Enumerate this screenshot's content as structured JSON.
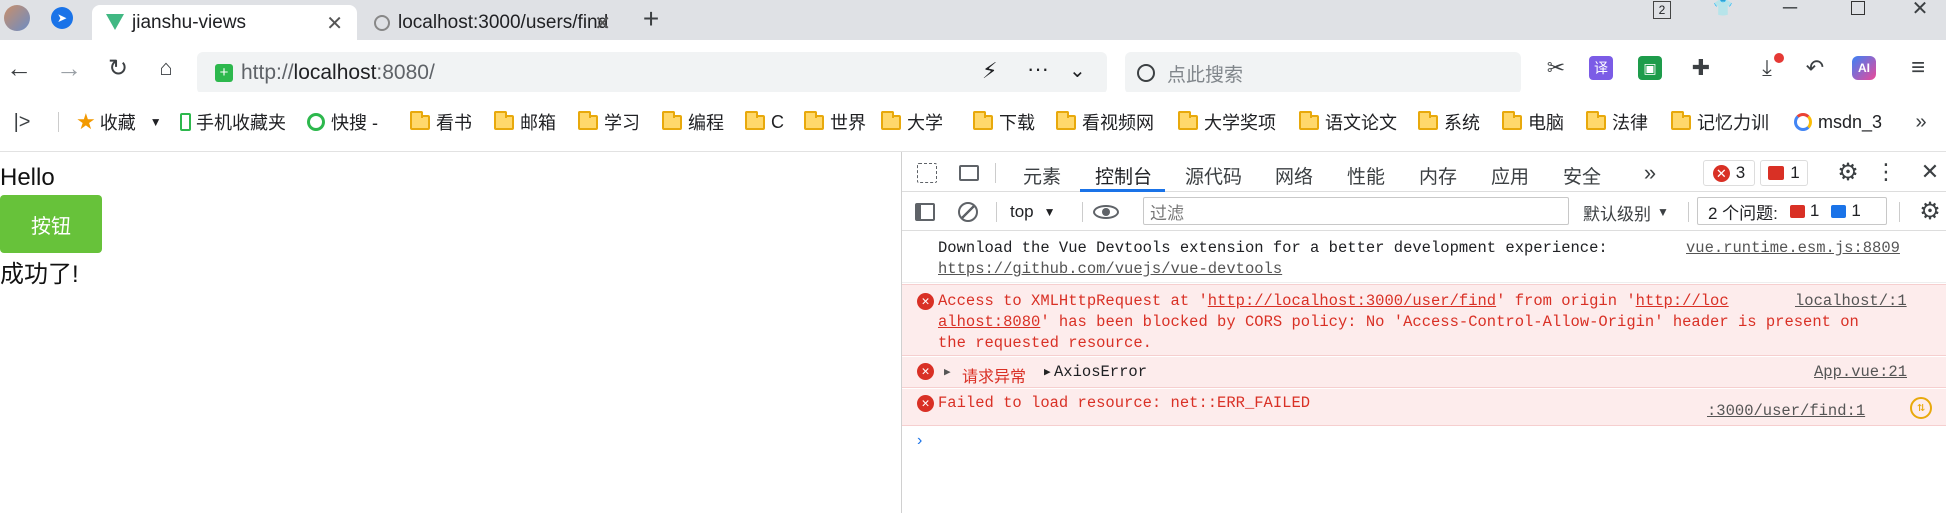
{
  "tabs": [
    {
      "title": "jianshu-views",
      "active": true
    },
    {
      "title": "localhost:3000/users/find",
      "active": false
    }
  ],
  "window": {
    "tab_count_badge": "2"
  },
  "address": {
    "prefix": "http://",
    "host": "localhost",
    "port": ":8080/"
  },
  "search": {
    "placeholder": "点此搜索"
  },
  "bookmarks": {
    "mobile": "手机收藏夹",
    "favorites": "收藏",
    "quick": "快搜 -",
    "folders": [
      "看书",
      "邮箱",
      "学习",
      "编程",
      "C",
      "世界",
      "大学",
      "下载",
      "看视频网",
      "大学奖项",
      "语文论文",
      "系统",
      "电脑",
      "法律",
      "记忆力训"
    ],
    "last": "msdn_3"
  },
  "page": {
    "hello": "Hello",
    "button": "按钮",
    "success": "成功了!"
  },
  "devtools": {
    "tabs": [
      "元素",
      "控制台",
      "源代码",
      "网络",
      "性能",
      "内存",
      "应用",
      "安全"
    ],
    "active_tab": "控制台",
    "error_count": "3",
    "warning_count": "1",
    "context": "top",
    "filter_placeholder": "过滤",
    "level": "默认级别",
    "issues_label": "2 个问题:",
    "issues_err": "1",
    "issues_info": "1",
    "messages": [
      {
        "line1": "Download the Vue Devtools extension for a better development experience:",
        "line2": "https://github.com/vuejs/vue-devtools",
        "source": "vue.runtime.esm.js:8809"
      },
      {
        "pre1": "Access to XMLHttpRequest at '",
        "url1": "http://localhost:3000/user/find",
        "mid1": "' from origin '",
        "url2a": "http://loc",
        "url2b": "alhost:8080",
        "rest2": "' has been blocked by CORS policy: No 'Access-Control-Allow-Origin' header is present on",
        "line3": "the requested resource.",
        "source": "localhost/:1"
      },
      {
        "label": "请求异常",
        "obj": "AxiosError",
        "source": "App.vue:21"
      },
      {
        "text": "Failed to load resource: net::ERR_FAILED",
        "source": ":3000/user/find:1"
      }
    ]
  },
  "colors": {
    "accent": "#1a73e8",
    "button": "#67c23a",
    "error": "#d93025",
    "error_bg": "#fdecec"
  }
}
